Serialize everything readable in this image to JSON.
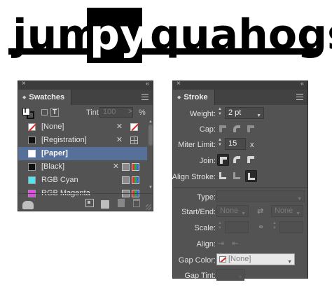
{
  "logo": {
    "text": "jumpy quahogs"
  },
  "swatches": {
    "tab_label": "Swatches",
    "close_glyph": "×",
    "collapse_glyph": "«",
    "fill_stroke_glyph": "T",
    "text_glyph": "T",
    "tint_label": "Tint:",
    "tint_value": "100",
    "tint_arrow": ">",
    "percent": "%",
    "items": [
      {
        "name": "[None]"
      },
      {
        "name": "[Registration]"
      },
      {
        "name": "[Paper]"
      },
      {
        "name": "[Black]"
      },
      {
        "name": "RGB Cyan"
      },
      {
        "name": "RGB Magenta"
      }
    ],
    "selected": "[Paper]",
    "colors": {
      "registration": "#111111",
      "paper": "#ffffff",
      "black": "#111111",
      "cyan": "#4fe4ee",
      "magenta": "#e047e6",
      "selection": "#56709a"
    },
    "bottom_icons": [
      "cc-library-icon",
      "swatch-views-icon",
      "new-color-group-icon",
      "new-swatch-icon",
      "delete-swatch-icon"
    ]
  },
  "stroke": {
    "tab_label": "Stroke",
    "close_glyph": "×",
    "collapse_glyph": "«",
    "weight_label": "Weight:",
    "weight_value": "2 pt",
    "cap_label": "Cap:",
    "miter_label": "Miter Limit:",
    "miter_value": "15",
    "miter_suffix": "x",
    "join_label": "Join:",
    "align_label": "Align Stroke:",
    "type_label": "Type:",
    "start_end_label": "Start/End:",
    "start_value": "None",
    "end_value": "None",
    "scale_label": "Scale:",
    "align2_label": "Align:",
    "gap_color_label": "Gap Color:",
    "gap_color_value": "[None]",
    "gap_tint_label": "Gap Tint:",
    "gap_tint_arrow": ">"
  }
}
